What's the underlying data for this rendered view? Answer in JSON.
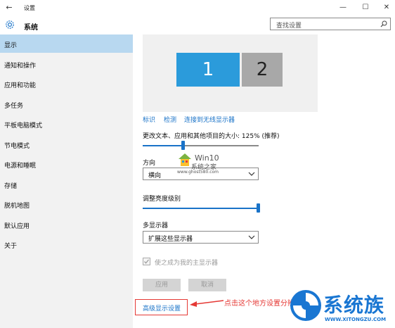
{
  "window": {
    "title": "设置",
    "back_glyph": "←",
    "minimize_glyph": "—",
    "maximize_glyph": "☐",
    "close_glyph": "✕"
  },
  "header": {
    "section_title": "系统",
    "search_placeholder": "查找设置"
  },
  "sidebar": {
    "items": [
      {
        "label": "显示",
        "active": true
      },
      {
        "label": "通知和操作"
      },
      {
        "label": "应用和功能"
      },
      {
        "label": "多任务"
      },
      {
        "label": "平板电脑模式"
      },
      {
        "label": "节电模式"
      },
      {
        "label": "电源和睡眠"
      },
      {
        "label": "存储"
      },
      {
        "label": "脱机地图"
      },
      {
        "label": "默认应用"
      },
      {
        "label": "关于"
      }
    ]
  },
  "display": {
    "monitor_1": "1",
    "monitor_2": "2",
    "links": {
      "identify": "标识",
      "detect": "检测",
      "wireless": "连接到无线显示器"
    },
    "scale_label": "更改文本、应用和其他项目的大小: 125% (推荐)",
    "scale_level": 0.35,
    "orientation_label": "方向",
    "orientation_value": "横向",
    "brightness_label": "调整亮度级别",
    "brightness_level": 1.0,
    "multi_display_label": "多显示器",
    "multi_display_value": "扩展这些显示器",
    "make_main_label": "使之成为我的主显示器",
    "apply_button": "应用",
    "cancel_button": "取消",
    "advanced_link": "高级显示设置"
  },
  "annotation": {
    "note": "点击这个地方设置分辨率",
    "color": "#e53935"
  },
  "watermarks": {
    "win10_title": "Win10",
    "win10_sub": "系统之家",
    "win10_url": "www.ghost580.com",
    "logo_name": "系统族",
    "logo_url": "WWW.XITONGZU.COM"
  },
  "colors": {
    "accent": "#1a73c8",
    "active_nav": "#b8d8f0",
    "monitor_primary": "#2b9bdb",
    "monitor_secondary": "#a8a8a8"
  }
}
